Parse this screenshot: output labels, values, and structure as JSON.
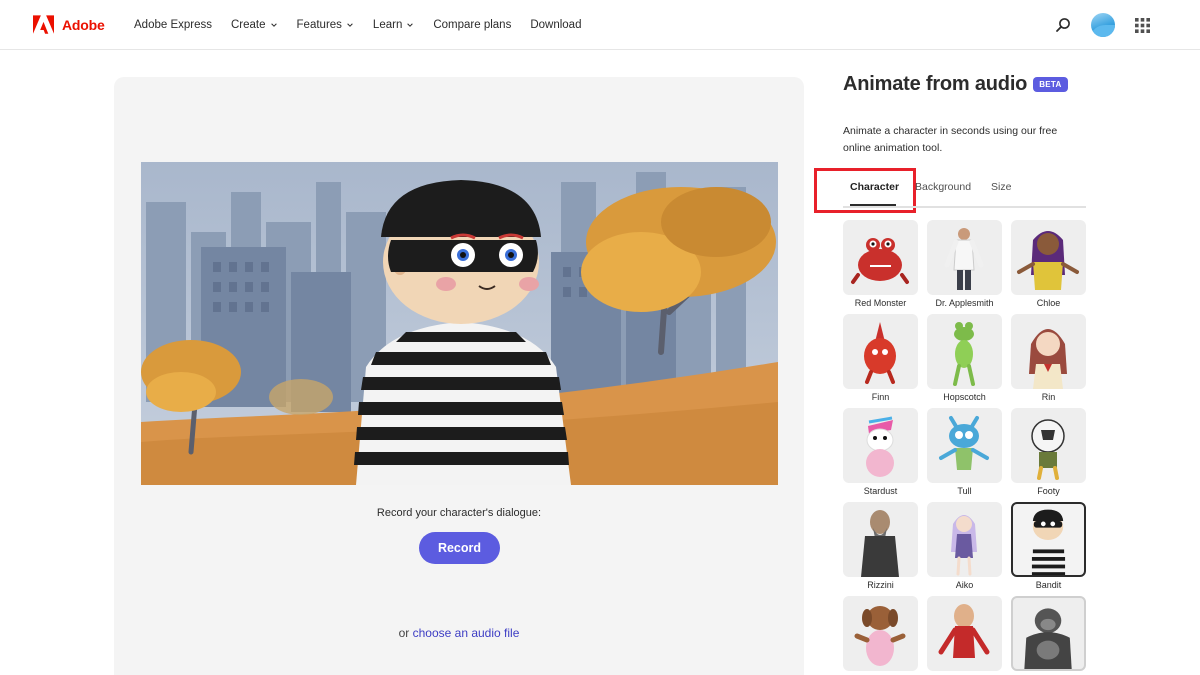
{
  "brand": {
    "name": "Adobe",
    "color": "#eb1000"
  },
  "nav": {
    "links": [
      {
        "label": "Adobe Express",
        "dropdown": false
      },
      {
        "label": "Create",
        "dropdown": true
      },
      {
        "label": "Features",
        "dropdown": true
      },
      {
        "label": "Learn",
        "dropdown": true
      },
      {
        "label": "Compare plans",
        "dropdown": false
      },
      {
        "label": "Download",
        "dropdown": false
      }
    ],
    "icons": [
      "search-icon",
      "avatar",
      "app-grid-icon"
    ]
  },
  "preview": {
    "record_caption": "Record your character's dialogue:",
    "record_label": "Record",
    "audio_prefix": "or ",
    "audio_link": "choose an audio file"
  },
  "panel": {
    "title": "Animate from audio",
    "badge": "BETA",
    "description": "Animate a character in seconds using our free online animation tool.",
    "tabs": [
      "Character",
      "Background",
      "Size"
    ],
    "active_tab": "Character",
    "characters": [
      {
        "name": "Red Monster"
      },
      {
        "name": "Dr. Applesmith"
      },
      {
        "name": "Chloe"
      },
      {
        "name": "Finn"
      },
      {
        "name": "Hopscotch"
      },
      {
        "name": "Rin"
      },
      {
        "name": "Stardust"
      },
      {
        "name": "Tull"
      },
      {
        "name": "Footy"
      },
      {
        "name": "Rizzini"
      },
      {
        "name": "Aiko"
      },
      {
        "name": "Bandit",
        "selected": true
      },
      {
        "name": ""
      },
      {
        "name": ""
      },
      {
        "name": ""
      }
    ]
  },
  "colors": {
    "accent": "#5c5ce0",
    "link": "#3d3dc4",
    "highlight": "#e8202a"
  }
}
